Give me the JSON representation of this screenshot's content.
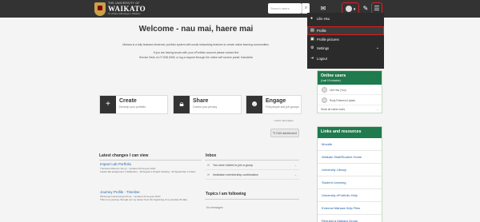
{
  "header": {
    "logo_small": "THE UNIVERSITY OF",
    "logo_name": "WAIKATO",
    "logo_maori": "Te Whare Wānanga o Waikato",
    "search_placeholder": "Search users"
  },
  "user_menu": {
    "items": [
      {
        "label": "Lilin Hsu",
        "icon": "user-icon"
      },
      {
        "label": "Profile",
        "icon": "id-card-icon",
        "active": true
      },
      {
        "label": "Profile pictures",
        "icon": "image-icon"
      },
      {
        "label": "Settings",
        "icon": "gear-icon",
        "has_submenu": true
      },
      {
        "label": "Logout",
        "icon": "logout-icon"
      }
    ]
  },
  "welcome": {
    "title": "Welcome - nau mai, haere mai",
    "intro": "Mahara is a fully featured electronic portfolio system with social networking features to create online learning communities.",
    "help1": "If you are having issues with your ePortfolio account please contact the",
    "help2": "Service Desk on 07 838 4008, or log a request through the online self service portal: Kahukiritu"
  },
  "actions": [
    {
      "title": "Create",
      "subtitle": "Develop your portfolio",
      "icon": "plus-icon"
    },
    {
      "title": "Share",
      "subtitle": "Control your privacy",
      "icon": "lock-icon"
    },
    {
      "title": "Engage",
      "subtitle": "Find people and join groups",
      "icon": "people-icon"
    }
  ],
  "more_info": "» More information",
  "edit_dashboard": "Edit dashboard",
  "latest_changes": {
    "title": "Latest changes I can view",
    "items": [
      {
        "title": "Impact Lab Portfolio",
        "meta": "Translate Mahara (Temp) - Updated 28 August 2020",
        "desc": "Impact lab assignment 1 Reflection - 18 August 1 Project tracking - 20 September 1 Notes"
      },
      {
        "title": "Journey Profile - Timeline",
        "meta": "Mihiranga Kuikentanga Monty - Updated 26 August 2020",
        "desc": "This is my journey through out my career from the beginning of my studies till date."
      }
    ]
  },
  "inbox": {
    "title": "Inbox",
    "items": [
      {
        "text": "You were invited to join a group"
      },
      {
        "text": "Institution membership confirmation"
      }
    ]
  },
  "topics": {
    "title": "Topics I am following",
    "empty": "No messages"
  },
  "online_users": {
    "title": "Online users",
    "subtitle": "(Last 10 minutes)",
    "users": [
      "Lilin Hsu (You)",
      "Rudy Felemeni Lipiata"
    ],
    "show_all": "Show all online users"
  },
  "links": {
    "title": "Links and resources",
    "items": [
      "Moodle",
      "Waikato Staff/Student Home",
      "University Library",
      "Student Learning",
      "University ePortfolio Help",
      "External Mahara Help Files",
      "Request a Mahara Group"
    ]
  },
  "colors": {
    "header": "#333333",
    "accent_green": "#1f7a4d",
    "highlight_red": "#e02020",
    "link_blue": "#1f5fa0"
  }
}
